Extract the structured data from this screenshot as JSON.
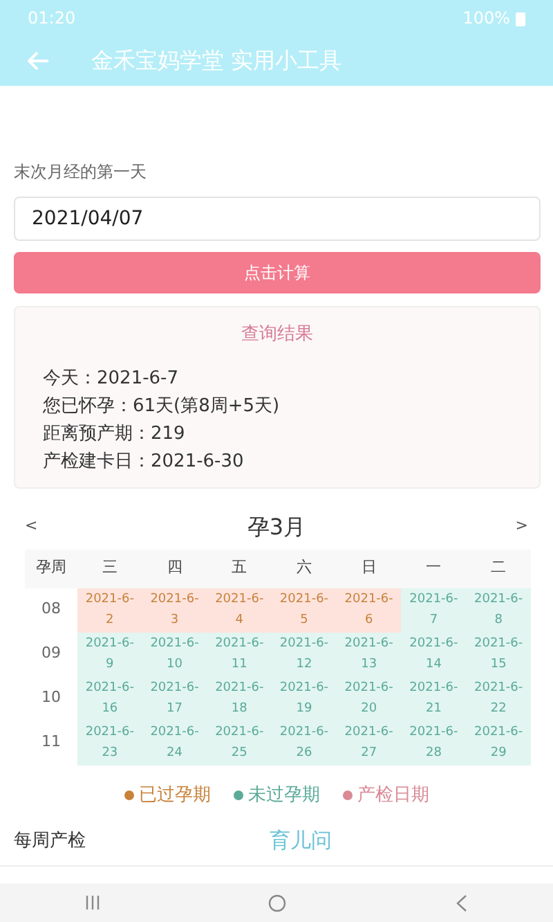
{
  "status_bar": {
    "time": "01:20",
    "battery": "100%"
  },
  "header": {
    "title": "金禾宝妈学堂 实用小工具"
  },
  "form": {
    "label": "末次月经的第一天",
    "value": "2021/04/07",
    "button": "点击计算"
  },
  "result": {
    "title": "查询结果",
    "lines": [
      "今天：2021-6-7",
      "您已怀孕：61天(第8周+5天)",
      "距离预产期：219",
      "产检建卡日：2021-6-30"
    ]
  },
  "calendar": {
    "title": "孕3月",
    "prev": "<",
    "next": ">",
    "week_header": "孕周",
    "days": [
      "三",
      "四",
      "五",
      "六",
      "日",
      "一",
      "二"
    ],
    "rows": [
      {
        "week": "08",
        "cells": [
          {
            "date": "2021-6-2",
            "passed": true
          },
          {
            "date": "2021-6-3",
            "passed": true
          },
          {
            "date": "2021-6-4",
            "passed": true
          },
          {
            "date": "2021-6-5",
            "passed": true
          },
          {
            "date": "2021-6-6",
            "passed": true
          },
          {
            "date": "2021-6-7",
            "passed": false
          },
          {
            "date": "2021-6-8",
            "passed": false
          }
        ]
      },
      {
        "week": "09",
        "cells": [
          {
            "date": "2021-6-9",
            "passed": false
          },
          {
            "date": "2021-6-10",
            "passed": false
          },
          {
            "date": "2021-6-11",
            "passed": false
          },
          {
            "date": "2021-6-12",
            "passed": false
          },
          {
            "date": "2021-6-13",
            "passed": false
          },
          {
            "date": "2021-6-14",
            "passed": false
          },
          {
            "date": "2021-6-15",
            "passed": false
          }
        ]
      },
      {
        "week": "10",
        "cells": [
          {
            "date": "2021-6-16",
            "passed": false
          },
          {
            "date": "2021-6-17",
            "passed": false
          },
          {
            "date": "2021-6-18",
            "passed": false
          },
          {
            "date": "2021-6-19",
            "passed": false
          },
          {
            "date": "2021-6-20",
            "passed": false
          },
          {
            "date": "2021-6-21",
            "passed": false
          },
          {
            "date": "2021-6-22",
            "passed": false
          }
        ]
      },
      {
        "week": "11",
        "cells": [
          {
            "date": "2021-6-23",
            "passed": false
          },
          {
            "date": "2021-6-24",
            "passed": false
          },
          {
            "date": "2021-6-25",
            "passed": false
          },
          {
            "date": "2021-6-26",
            "passed": false
          },
          {
            "date": "2021-6-27",
            "passed": false
          },
          {
            "date": "2021-6-28",
            "passed": false
          },
          {
            "date": "2021-6-29",
            "passed": false
          }
        ]
      }
    ]
  },
  "legend": [
    {
      "label": "已过孕期",
      "color": "#c8823c"
    },
    {
      "label": "未过孕期",
      "color": "#5aaa98"
    },
    {
      "label": "产检日期",
      "color": "#d98a95"
    }
  ],
  "weekly": {
    "title": "每周产检",
    "link": "育儿问"
  }
}
